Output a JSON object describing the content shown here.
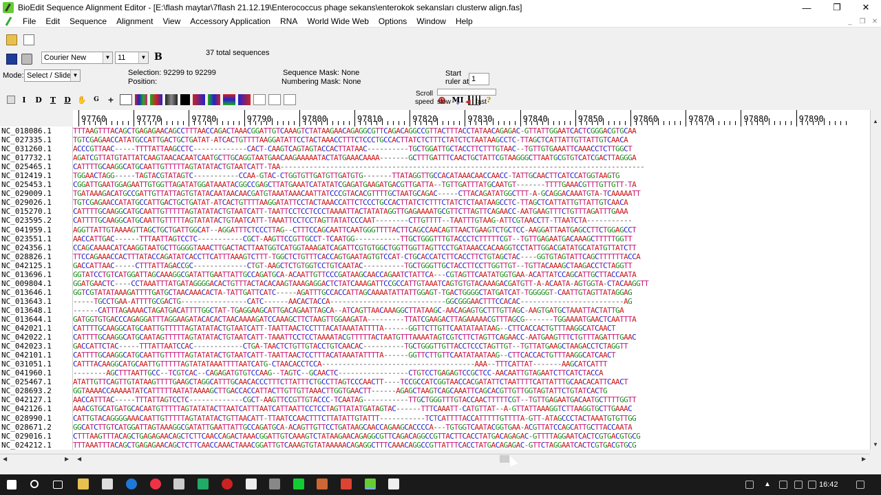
{
  "window": {
    "title": "BioEdit Sequence Alignment Editor - [E:\\flash maytar\\7flash 21.12.19\\Enterococcus phage sekans\\enterokok sekansları clusterw align.fas]",
    "min": "—",
    "max": "❐",
    "close": "✕"
  },
  "menu": [
    "File",
    "Edit",
    "Sequence",
    "Alignment",
    "View",
    "Accessory Application",
    "RNA",
    "World Wide Web",
    "Options",
    "Window",
    "Help"
  ],
  "toolbar": {
    "font_name": "Courier New",
    "font_size": "11",
    "bold_label": "B",
    "total_sequences": "37 total sequences",
    "mode_label": "Mode:",
    "mode_value": "Select / Slide",
    "selection_label": "Selection: 92299 to 92299",
    "position_label": "Position:",
    "sequence_mask": "Sequence Mask: None",
    "numbering_mask": "Numbering Mask: None",
    "start_ruler_label1": "Start",
    "start_ruler_label2": "ruler at:",
    "start_ruler_value": "1",
    "scroll_label": "Scroll",
    "speed_label": "speed",
    "slow_label": "slow",
    "fast_label": "fast",
    "tool_letters": [
      "I",
      "D",
      "T",
      "D"
    ],
    "ml_label": "MI"
  },
  "ruler": {
    "labels": [
      "97760",
      "97770",
      "97780",
      "97790",
      "97800",
      "97810",
      "97820",
      "97830",
      "97840",
      "97850",
      "97860",
      "97870",
      "97880",
      "97890"
    ]
  },
  "sequences": [
    {
      "name": "NC_018086.1",
      "seq": "TTTAAGTTTACAGCTGAGAGAACAGCCTTTAACCAGACTAAACGGATTGTCAAAGTCTATAAGAACAGAGGCGTTCAGACAGGCCGTTACTTTACCTATAACAGAGAC-GTTATTGGAATCACTCGGGACGTGCAA"
    },
    {
      "name": "NC_027335.1",
      "seq": "TGTCGAGAACCATATGCCATTGACTGCTGATAT-ATCACTGTTTTAAGGATATTCCTACTAAACCTTTCTCCCTGCCACTTATCTCTTTCTATCTCTAATAAGCCTC-TTAGCTCATTATTGTTATTGTCAACA"
    },
    {
      "name": "NC_031260.1",
      "seq": "ACCCGTTAAC-----TTTTATTAAGCCTC-------------CACT-CAAGTCAGTAGTACCACTTATAAC----------TGCTGGATTGCTACCTTCTTTGTAAC--TGTTGTGAAATTCAAACCTCTTGGCT"
    },
    {
      "name": "NC_017732.1",
      "seq": "AGATCGTTATGTATTATCAAGTAACACAATCAATGCTTGCAGGTAATGAACAAGAAAAATACTATGAAACAAAA-------GCTTTGATTTCAACTGCTATTCGTAAGGGCTTAATGCGTGTCATCGACTTAGGGA"
    },
    {
      "name": "NC_025465.1",
      "seq": "CATTTTGCAAGGCATGCAATTGTTTTTAGTATATACTGTAATCATT-TAA----------------------------------------------------------------------------------------"
    },
    {
      "name": "NC_012419.1",
      "seq": "TGGAACTAGG-----TAGTACGTATAGTC-----------CCAA-GTAC-CTGGTGTTGATGTTGATGTG-------TTATAGGTTGCCACATAAACAACCAACC-TATTGCAACTTCATCCATGGTAAGTG"
    },
    {
      "name": "NC_025453.1",
      "seq": "CGGATTGAATGGAGAATTGTGGTTAGATATGGATAAATACGGCCGAGCTTATGAAATCATATATCGAGATGAAGATGACGTTGATTA--TGTTGATTTATGCAATGT-------TTTTGAAACGTTTGTTGTT-TA"
    },
    {
      "name": "NC_029009.1",
      "seq": "TGATAAAGACATGCCGATTGTTATTAGTGTATACAATAACAACGATGTAAATAAACAATTATCCCGTACACGTTTTGCTAATGCAGAC-----CTTACAGATATGGCTTT-A-GCAGGACAAATGTA-TCAAAAATT"
    },
    {
      "name": "NC_029026.1",
      "seq": "TGTCGAGAACCATATGCCATTGACTGCTGATAT-ATCACTGTTTTAAGGATATTCCTACTAAACCATTCTCCCTGCCACTTATCTCTTTCTATCTCTAATAAGCCTC-TTAGCTCATTATTGTTATTGTCAACA"
    },
    {
      "name": "NC_015270.1",
      "seq": "CATTTTGCAAGGCATGCAATTGTTTTTAGTATATACTGTAATCATT-TAATTCCTCCTCCCTAAAATTACTATATAGGTTGAGAAAATGCGTTCTTAGTTCAGAACC-AATGAAGTTTCTGTTTAGATTTGAAA"
    },
    {
      "name": "NC_023595.2",
      "seq": "CATTTTGCAAGGCATGCAATTGTTTTTAGTATATACTGTAATCATT-TAAATTCCTCCTAGTTATATCCCAAT--------CTTGTTTT--TAATTTGTAAG-ATTCGTAACCTT-TTAATCTA-----------"
    },
    {
      "name": "NC_041959.1",
      "seq": "AGGTTATTGTAAAAGTTAGCTGCTGATTGGCAT--AGGATTTCTCCCTTAG--CTTTCCAGCAATTCAATGGGTTTTACTTCAGCCAACAGTTAACTGAAGTCTGCTCC-AAGGATTAATGAGCCTTCTGGAGCCT"
    },
    {
      "name": "NC_023551.1",
      "seq": "AACCATTGAC------TTTAATTAGTCCTC-----------CGCT-AAGTTCCGTTGCCT-TCAATGG-----------TTGCTGGGTTTGTACCCTCTTTTTCGT--TGTTGAGAATGACAAAGCTTTTTGGTT"
    },
    {
      "name": "NC_024356.1",
      "seq": "CCAGCAAAACATCAAGGTAATGCTTGGGGTAAACTTGACTACTTAATGGTCATGGTAAAGATCAGATTCGTGTGGCTGGTTGGTTAGTTCCTGATAAACCACAAGGTCCTATTGGACGATATGCATATGTTATCTT"
    },
    {
      "name": "NC_028826.1",
      "seq": "TTCCAGAAACCACTTTATACCAGATATCACCTTCATTTAAAGTCTTT-TGGCTCTGTTTCACCAGTGAATAGTGTCCAT-CTGCACCATCTTCACCTTCTGTAGCTAC----GGTGTAGTATTCAGCTTTTTTACCA"
    },
    {
      "name": "NC_042125.1",
      "seq": "GACCATTAAC-----CTTTATTAGACCGC-------------CTGT-AAGCTCTGTGGTCCTGTCAATAC----------TGCTGGGTTGCTACCTTCCTTGGTTGT--TGTTACAAAGCTAAGACCTCTAGGTT"
    },
    {
      "name": "NC_013696.1",
      "seq": "GGTATCCTGTCATGGATTAGCAAAGGCGATATTGAATTATTGCCAGATGCA-ACAATTGTTCCCGATAAGCAACCAGAATCTATTCA---CGTAGTTCAATATGGTGAA-ACATTATCCAGCATTGCTTACCAATA"
    },
    {
      "name": "NC_009804.1",
      "seq": "GGATGAACTC----CCTAAATTTATGATAGGGGACACTGTTTACTACACAAGTAAAGAGGACTCTATCAAAGATTCCGCCATTGTAAATCAGTGTGTACAAAGACGATGTT-A-ACAATA-AGTGGTA-CTACAAGGTT"
    },
    {
      "name": "NC_013646.1",
      "seq": "GGTCGTATATAAAGATTTTGATGCTAACAAACACTA-TATTGATTCATC-----AGATTTGCCACCATTAGCAAAATATTATTGGAGT-TGACTGGGGCTATGATCAT-TGGGGGT-CAATTGTAGTTATAGGAG"
    },
    {
      "name": "NC_013643.1",
      "seq": "-----TGCCTGAA-ATTTTGCGACTG----------------CATC------AACACTACCA----------------------------GGCGGGAACTTTCCACAC-------------------------AG"
    },
    {
      "name": "NC_013648.1",
      "seq": "------CATTTAGAAAACTAGATGACATTTTGGCTAT-TGAGGAAGCATTGACAGAATTAGCA--ATCAGTTAACAAAGGCTTATAAGC-AACAGAGTGCTTTGTTAGC-AAGTGATGCTAAATTACTATTGA"
    },
    {
      "name": "NC_013644.1",
      "seq": "GATGGTGTGACCCAGAGGATTTAGGAAGATACACACTAACAAAAGATCCAAAGCTTCTAAGTTGGAAGATA---------TTATCGAAGACTTAGAAAAACGTTTAGCG-------TGGAAAATGAACTCAATTTA"
    },
    {
      "name": "NC_042021.1",
      "seq": "CATTTTGCAAGGCATGCAATTGTTTTTAGTATATACTGTAATCATT-TAATTAACTCCTTTACATAAATATTTTA------GGTTCTTGTTCAATATAATAAG--CTTCACCACTGTTTAAGGCATCAACT"
    },
    {
      "name": "NC_042022.1",
      "seq": "CATTTTGCAAGGCATGCAATAGTTTTTAGTATATACTGTAATCATT-TAAATTCCTCCTAAAATACGTTTTTACTAATGTTTAAAATAGTCGTCTTCTAGTTCAGAACC-AATGAAGTTTCTGTTTAGATTTGAAC"
    },
    {
      "name": "NC_042023.1",
      "seq": "GACCATTCTAC-----TTTATTAATCCAC------------CTGA-TAACTCTGTTGTACCTGTCAACAC----------TGCTGGGTTGTTACCTCCCTAGTTGT--TGTTATGAAGCTAAGACCTCTAGGTT"
    },
    {
      "name": "NC_042101.1",
      "seq": "CATTTTGCAAGGCATGCAATTGTTTTTAGTATATACTGTAATCATT-TAATTAACTCCTTTACATAAATATTTTA------GGTTCTTGTTCAATATAATAAG--CTTCACCACTGTTTAAGGCATCAACT"
    },
    {
      "name": "NC_031051.1",
      "seq": "CATTTACAAGGCATGCAATTGTTTTTAGTATATAAATTTTAATCATG-CTAACACCTCCA-------------------------------------AAA--TTTCATTAT-------AAGCATCATTT"
    },
    {
      "name": "NC_041960.1",
      "seq": "--------AGCTTTAATTGCC--TCGTCAC--CAGAGATGTGTCCAAG--TAGTC--GCAACTC-----------------CTGTCCTGAGAGTCCGCTCC-AACAATTGTAGAATCTTCATCTACCA"
    },
    {
      "name": "NC_025467.1",
      "seq": "ATATTGTTCAGTTGTATAAGTTTTGAAGCTAGGCATTTGCAACACCCTTTCTTATTTCTGCCTTAGTCCCAACTT----TCCGCCATCGGTAACCACGATATTCTAATTTTCATTATTTGCAACACATTCAACT"
    },
    {
      "name": "NC_028693.2",
      "seq": "GGTAAAACCAAAAATATCATTTTTAATATAAAAGCTTGACCACCATTACTTGTTGTTAAACTTGGTGAACTT------AGAGCTAAGTCAGCAAATTCAGCACGTTGTTGGTAGTATTCTGTATCACTG"
    },
    {
      "name": "NC_042127.1",
      "seq": "AACCATTTAC-----TTTATTAGTCCTC-------------CGCT-AAGTTCCGTTGTACCC-TCAATAG-----------TTGCTGGGTTTGTACCAACTTTTTCGT--TGTTGAGAATGACAATGCTTTTGGTT"
    },
    {
      "name": "NC_042126.1",
      "seq": "AAACGTGCATGATGCACAATGTTTTTAGTATATACTTAATCATTTAATCATTAATTCCTCCTAGTTATATGATAGTAC------TTTCAAATT-CATGTTAT--A-GTTATTAAAGGTCTTAAGGTGCTTGAAAC"
    },
    {
      "name": "NC_028990.1",
      "seq": "CATTGTACAGGGGAAACAATTGTTTTTAGTATATACTGTTAACATT-TTAATCCAACTTTCTTATATTGTATTT-----------TCTCATTTTACCATTTTTGTTTTA-GTT-ATAGCCCTACTAAATGTGTTGG"
    },
    {
      "name": "NC_028671.2",
      "seq": "GGCATCTTGTCATGGATTAGTAAAGGCGATATTGAATTATTGCCAGATGCA-ACAGTTGTTCCTGATAAGCAACCAGAAGCACCCCA---TGTGGTCAATACGGTGAA-ACGTTATCCAGCATTGCTTACCAATA"
    },
    {
      "name": "NC_029016.1",
      "seq": "CTTTAAGTTTACAGCTGAGAGAACAGCTCTTCAACCAGACTAAACGGATTGTCAAAGTCTATAAGAACAGAGGCGTTCAGACAGGCCGTTACTTCACCTATGACAGAGAC-GTTTTAGGAATCACTCGTGACGTGCG"
    },
    {
      "name": "NC_024212.1",
      "seq": "TTTAAATTTACAGCTGAGAGAACAGCTCTTCAACCAAACTAAACGGATTGTCAAAGTGTATAAAAACAGAGGCTTTCAAACAGGCCGTTATTTCACCTATGACAGAGAC-GTTCTAGGAATCACTCGTGACGTGCG"
    }
  ],
  "taskbar": {
    "clock": "16:42"
  }
}
